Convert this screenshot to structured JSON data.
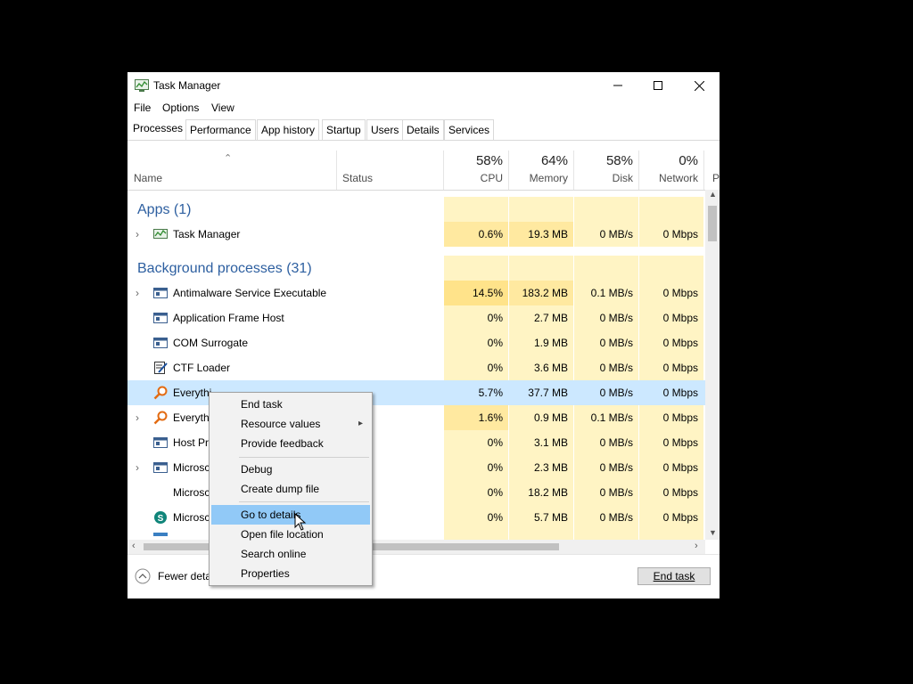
{
  "window": {
    "title": "Task Manager"
  },
  "menu": [
    "File",
    "Options",
    "View"
  ],
  "tabs": [
    "Processes",
    "Performance",
    "App history",
    "Startup",
    "Users",
    "Details",
    "Services"
  ],
  "columns": {
    "name": "Name",
    "status": "Status",
    "cpu": {
      "pct": "58%",
      "label": "CPU"
    },
    "memory": {
      "pct": "64%",
      "label": "Memory"
    },
    "disk": {
      "pct": "58%",
      "label": "Disk"
    },
    "network": {
      "pct": "0%",
      "label": "Network"
    },
    "power": "P"
  },
  "groups": {
    "apps": "Apps (1)",
    "background": "Background processes (31)"
  },
  "rows": [
    {
      "name": "Task Manager",
      "cpu": "0.6%",
      "memory": "19.3 MB",
      "disk": "0 MB/s",
      "network": "0 Mbps"
    },
    {
      "name": "Antimalware Service Executable",
      "cpu": "14.5%",
      "memory": "183.2 MB",
      "disk": "0.1 MB/s",
      "network": "0 Mbps"
    },
    {
      "name": "Application Frame Host",
      "cpu": "0%",
      "memory": "2.7 MB",
      "disk": "0 MB/s",
      "network": "0 Mbps"
    },
    {
      "name": "COM Surrogate",
      "cpu": "0%",
      "memory": "1.9 MB",
      "disk": "0 MB/s",
      "network": "0 Mbps"
    },
    {
      "name": "CTF Loader",
      "cpu": "0%",
      "memory": "3.6 MB",
      "disk": "0 MB/s",
      "network": "0 Mbps"
    },
    {
      "name": "Everythi",
      "cpu": "5.7%",
      "memory": "37.7 MB",
      "disk": "0 MB/s",
      "network": "0 Mbps"
    },
    {
      "name": "Everyth",
      "cpu": "1.6%",
      "memory": "0.9 MB",
      "disk": "0.1 MB/s",
      "network": "0 Mbps"
    },
    {
      "name": "Host Pr",
      "cpu": "0%",
      "memory": "3.1 MB",
      "disk": "0 MB/s",
      "network": "0 Mbps"
    },
    {
      "name": "Microsc",
      "cpu": "0%",
      "memory": "2.3 MB",
      "disk": "0 MB/s",
      "network": "0 Mbps"
    },
    {
      "name": "Microsc",
      "cpu": "0%",
      "memory": "18.2 MB",
      "disk": "0 MB/s",
      "network": "0 Mbps"
    },
    {
      "name": "Microsc",
      "cpu": "0%",
      "memory": "5.7 MB",
      "disk": "0 MB/s",
      "network": "0 Mbps"
    }
  ],
  "footer": {
    "fewer_details": "Fewer deta",
    "end_task": "End task"
  },
  "context_menu": [
    "End task",
    "Resource values",
    "Provide feedback",
    "Debug",
    "Create dump file",
    "Go to details",
    "Open file location",
    "Search online",
    "Properties"
  ],
  "colors": {
    "heat_light": "#fff4c4",
    "heat_medium": "#ffe9a0",
    "selection": "#cce8ff",
    "menu_highlight": "#91c9f7",
    "group_title": "#2d5fa0"
  }
}
